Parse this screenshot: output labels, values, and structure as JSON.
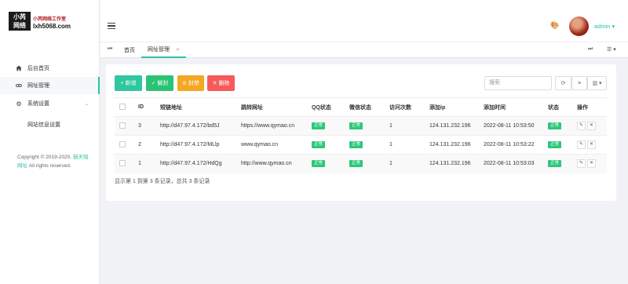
{
  "logo": {
    "mark_line1": "小芮",
    "mark_line2": "网络",
    "title": "小芮网络工作室",
    "site": "lxh5068.com"
  },
  "sidebar": {
    "items": [
      {
        "label": "后台首页",
        "icon": "home-icon"
      },
      {
        "label": "网址管理",
        "icon": "link-icon"
      },
      {
        "label": "系统设置",
        "icon": "gear-icon"
      }
    ],
    "sub_items": [
      {
        "label": "网站信息设置"
      }
    ],
    "copyright_prefix": "Copyright © 2019-2020.",
    "copyright_link": "猫天短网址",
    "copyright_suffix": " All rights reserved."
  },
  "header": {
    "user": "admin"
  },
  "tabs": [
    {
      "label": "首页"
    },
    {
      "label": "网址管理"
    }
  ],
  "toolbar": {
    "add": "+ 新增",
    "unban": "✓ 解封",
    "ban": "⊘ 封禁",
    "delete": "✕ 删除",
    "search_placeholder": "搜索"
  },
  "table": {
    "headers": [
      "ID",
      "短链地址",
      "跳转网址",
      "QQ状态",
      "微信状态",
      "访问次数",
      "添加ip",
      "添加时间",
      "状态",
      "操作"
    ],
    "rows": [
      {
        "id": "3",
        "short": "http://d47.97.4.172/bd5J",
        "target": "https://www.qymao.cn",
        "qq": "正常",
        "wechat": "正常",
        "visits": "1",
        "ip": "124.131.232.196",
        "time": "2022-08-11 10:53:50",
        "status": "正常"
      },
      {
        "id": "2",
        "short": "http://d47.97.4.172/MLlp",
        "target": "www.qymao.cn",
        "qq": "正常",
        "wechat": "正常",
        "visits": "1",
        "ip": "124.131.232.196",
        "time": "2022-08-11 10:53:22",
        "status": "正常"
      },
      {
        "id": "1",
        "short": "http://d47.97.4.172/HdQg",
        "target": "http://www.qymao.cn",
        "qq": "正常",
        "wechat": "正常",
        "visits": "1",
        "ip": "124.131.232.196",
        "time": "2022-08-11 10:53:03",
        "status": "正常"
      }
    ],
    "summary": "显示第 1 到第 3 条记录，总共 3 条记录"
  },
  "colors": {
    "accent": "#2ac3a8",
    "success": "#2ec77a",
    "warning": "#f5a623",
    "danger": "#f75a5a"
  }
}
